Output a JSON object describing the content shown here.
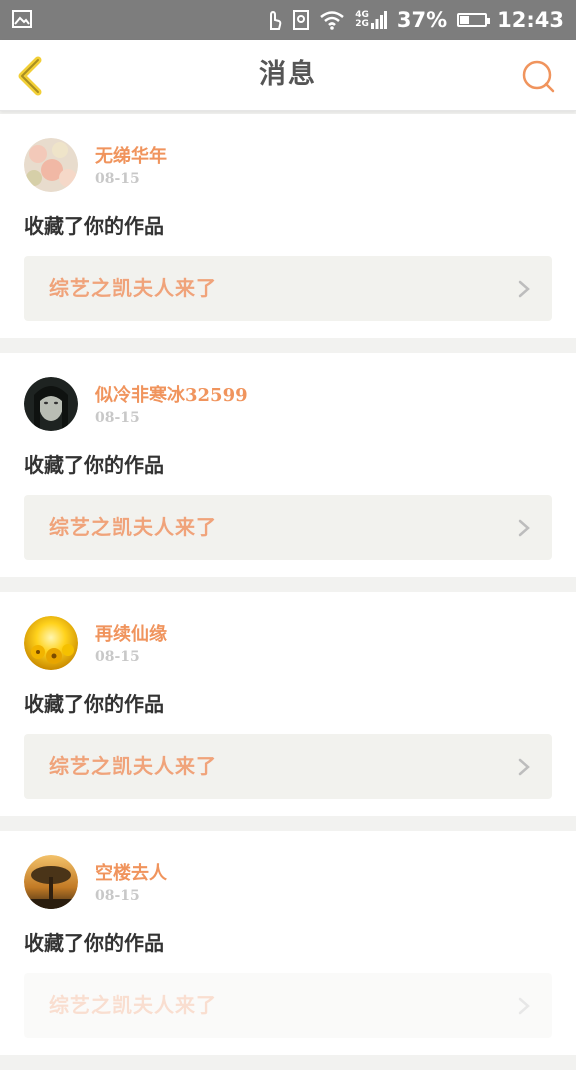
{
  "status_bar": {
    "network_top": "4G",
    "network_bottom": "2G",
    "battery": "37%",
    "battery_level": 0.37,
    "time": "12:43"
  },
  "header": {
    "title": "消息",
    "back_icon": "back-chevron-icon",
    "search_icon": "search-icon",
    "accent": "#f0945d"
  },
  "messages": [
    {
      "user": "无绨华年",
      "date": "08-15",
      "action": "收藏了你的作品",
      "work_title": "综艺之凯夫人来了",
      "avatar": "avatar-flowers"
    },
    {
      "user": "似冷非寒冰32599",
      "date": "08-15",
      "action": "收藏了你的作品",
      "work_title": "综艺之凯夫人来了",
      "avatar": "avatar-portrait"
    },
    {
      "user": "再续仙缘",
      "date": "08-15",
      "action": "收藏了你的作品",
      "work_title": "综艺之凯夫人来了",
      "avatar": "avatar-sunflowers"
    },
    {
      "user": "空楼去人",
      "date": "08-15",
      "action": "收藏了你的作品",
      "work_title": "综艺之凯夫人来了",
      "avatar": "avatar-tree-sunset"
    }
  ]
}
